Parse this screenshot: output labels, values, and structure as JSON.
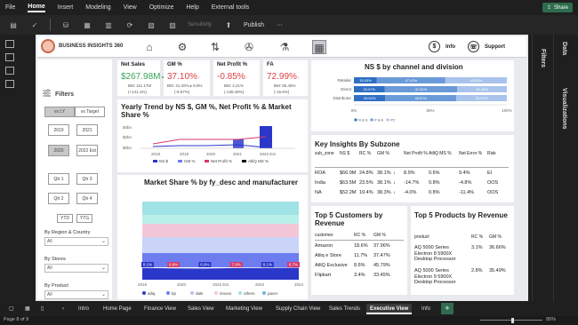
{
  "menu": {
    "items": [
      "File",
      "Home",
      "Insert",
      "Modeling",
      "View",
      "Optimize",
      "Help",
      "External tools"
    ],
    "active": "Home",
    "share": "Share"
  },
  "toolbar": {
    "sensitivity": "Sensitivity",
    "publish": "Publish",
    "more": "···"
  },
  "panes": {
    "filters": "Filters",
    "visualizations": "Visualizations",
    "data": "Data"
  },
  "header": {
    "brand": "BUSINESS INSIGHTS 360",
    "info": "Info",
    "support": "Support"
  },
  "sidebar": {
    "title": "Filters",
    "toggle": [
      "vs LY",
      "vs Target"
    ],
    "years": [
      "2019",
      "2021",
      "2020",
      "2022 Est"
    ],
    "quarters": [
      "Qtr 1",
      "Qtr 3",
      "Qtr 2",
      "Qtr 4"
    ],
    "ytd": [
      "YTD",
      "YTG"
    ],
    "region_label": "By Region & Country",
    "region_value": "All",
    "stores_label": "By Stores",
    "stores_value": "All",
    "product_label": "By Product",
    "product_value": "All"
  },
  "kpis": [
    {
      "title": "Net Sales",
      "value": "$267.98M",
      "mark": "✓",
      "bm": "BM: 111.17M",
      "change": "(+141.1%)",
      "color": "#3aa35a"
    },
    {
      "title": "GM %",
      "value": "37.10%",
      "mark": "↑",
      "bm": "BM: 41.20% ▸ 8.9%",
      "change": "(-9.97%)",
      "color": "#d94040"
    },
    {
      "title": "Net Profit %",
      "value": "-0.85%",
      "mark": "↑",
      "bm": "BM: 2.21%",
      "change": "(-138.48%)",
      "color": "#d94040"
    },
    {
      "title": "FA",
      "value": "72.99%",
      "mark": "↑",
      "bm": "BM: 86.45%",
      "change": "(-15.6%)",
      "color": "#d94040"
    }
  ],
  "channel": {
    "title": "NS $ by channel and division",
    "rows": [
      {
        "name": "Retailer",
        "values": [
          15.93,
          47.42,
          42.65
        ]
      },
      {
        "name": "Direct",
        "values": [
          20.07,
          47.51,
          32.42
        ]
      },
      {
        "name": "Distributor",
        "values": [
          20.52,
          46.51,
          32.97
        ]
      }
    ],
    "labels": [
      [
        "15.93%",
        "47.42%",
        "42.65%"
      ],
      [
        "20.07%",
        "47.51%",
        "32.42%"
      ],
      [
        "20.52%",
        "46.51%",
        "32.97%"
      ]
    ],
    "axis": [
      "0%",
      "50%",
      "100%"
    ],
    "legend": [
      "N & S",
      "P & A",
      "PC"
    ],
    "colors": [
      "#2f6fc4",
      "#6a9ad8",
      "#a9c4ec"
    ]
  },
  "trend": {
    "title": "Yearly Trend by NS $, GM %, Net Profit % & Market Share %",
    "yticks": [
      "$4bn",
      "$2bn",
      "$0bn"
    ],
    "xticks": [
      "2018",
      "2019",
      "2020",
      "2021",
      "2022 Est"
    ],
    "legend": [
      "NS $",
      "GM %",
      "Net Profit %",
      "AtliQ MS %"
    ]
  },
  "chart_data": [
    {
      "type": "bar",
      "title": "NS $ by channel and division",
      "categories": [
        "Retailer",
        "Direct",
        "Distributor"
      ],
      "series": [
        {
          "name": "N & S",
          "values": [
            15.93,
            20.07,
            20.52
          ]
        },
        {
          "name": "P & A",
          "values": [
            47.42,
            47.51,
            46.51
          ]
        },
        {
          "name": "PC",
          "values": [
            42.65,
            32.42,
            32.97
          ]
        }
      ]
    },
    {
      "type": "area",
      "title": "Market Share % by fy_desc and manufacturer",
      "x": [
        "2019",
        "2020",
        "2021",
        "2022 Est",
        "2023",
        "2024"
      ],
      "series": [
        {
          "name": "atliq",
          "values": [
            8.1,
            6.8,
            6.6,
            7.9,
            8.1,
            8.7
          ]
        },
        {
          "name": "bp",
          "values": [
            null,
            null,
            null,
            null,
            null,
            null
          ]
        },
        {
          "name": "dale",
          "values": [
            null,
            null,
            null,
            null,
            null,
            null
          ]
        },
        {
          "name": "innovo",
          "values": [
            null,
            null,
            null,
            null,
            null,
            null
          ]
        },
        {
          "name": "others",
          "values": [
            null,
            null,
            null,
            null,
            null,
            null
          ]
        },
        {
          "name": "pacer",
          "values": [
            null,
            null,
            null,
            null,
            null,
            null
          ]
        }
      ]
    }
  ],
  "marketshare": {
    "title": "Market Share % by fy_desc and manufacturer",
    "labels": [
      "8.1%",
      "6.8%",
      "6.6%",
      "7.9%",
      "8.1%",
      "8.7%"
    ],
    "xticks": [
      "2019",
      "2020",
      "2022 Est",
      "2023",
      "2024"
    ],
    "legend": [
      "atliq",
      "bp",
      "dale",
      "innovo",
      "others",
      "pacer"
    ],
    "colors": [
      "#2b37c8",
      "#6d7df0",
      "#b3c3f4",
      "#f4c7d8",
      "#9fe3e6",
      "#6fb4d8"
    ]
  },
  "subzone": {
    "title": "Key Insights By Subzone",
    "headers": [
      "sub_zone",
      "NS $",
      "RC %",
      "GM %",
      "",
      "Net Profit %",
      "AtliQ MS %",
      "Net Error %",
      "Risk"
    ],
    "rows": [
      [
        "ROA",
        "$66.9M",
        "24.8%",
        "38.1%",
        "↓",
        "8.9%",
        "0.6%",
        "9.4%",
        "EI"
      ],
      [
        "India",
        "$63.5M",
        "23.5%",
        "38.1%",
        "↓",
        "-14.7%",
        "0.8%",
        "-4.8%",
        "OOS"
      ],
      [
        "NA",
        "$52.2M",
        "19.4%",
        "38.3%",
        "↓",
        "-4.0%",
        "0.8%",
        "-11.4%",
        "OOS"
      ]
    ]
  },
  "customers": {
    "title": "Top 5 Customers by Revenue",
    "headers": [
      "customer",
      "RC %",
      "GM %"
    ],
    "rows": [
      [
        "Amazon",
        "18.6%",
        "37.96%"
      ],
      [
        "Atliq e Store",
        "11.7%",
        "37.47%"
      ],
      [
        "AtliQ Exclusive",
        "8.6%",
        "45.79%"
      ],
      [
        "Flipkart",
        "3.4%",
        "33.45%"
      ]
    ]
  },
  "products": {
    "title": "Top 5 Products by Revenue",
    "headers": [
      "product",
      "RC %",
      "GM %"
    ],
    "rows": [
      [
        "AQ 5000 Series Electron 8 5900X Desktop Processor",
        "3.1%",
        "36.66%"
      ],
      [
        "AQ 5000 Series Electron 9 5900X Desktop Processor",
        "2.8%",
        "35.49%"
      ]
    ]
  },
  "tabs": {
    "items": [
      "Intro",
      "Home Page",
      "Finance View",
      "Sales View",
      "Marketing View",
      "Supply Chain View",
      "Sales Trends",
      "Executive View",
      "Info"
    ],
    "active": "Executive View"
  },
  "status": {
    "page": "Page 8 of 9",
    "zoom": "95%"
  }
}
